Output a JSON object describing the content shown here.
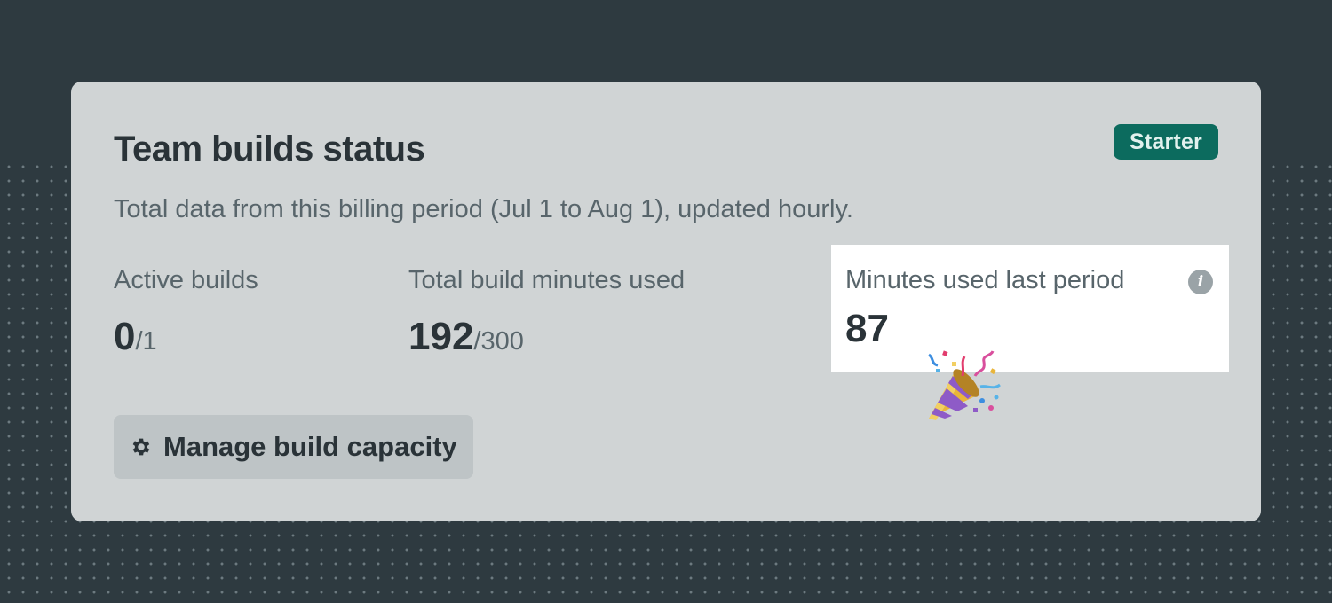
{
  "card": {
    "title": "Team builds status",
    "badge": "Starter",
    "subtitle": "Total data from this billing period (Jul 1 to Aug 1), updated hourly."
  },
  "stats": {
    "active_builds": {
      "label": "Active builds",
      "value": "0",
      "limit": "/1"
    },
    "total_minutes": {
      "label": "Total build minutes used",
      "value": "192",
      "limit": "/300"
    },
    "last_period": {
      "label": "Minutes used last period",
      "value": "87",
      "info_icon": "info-icon"
    }
  },
  "button": {
    "label": "Manage build capacity",
    "icon": "gear-icon"
  },
  "decoration": {
    "emoji": "party-popper-icon"
  },
  "colors": {
    "background": "#2e3a40",
    "card": "#d0d4d5",
    "badge": "#0c6b5e",
    "text_primary": "#2a3338",
    "text_secondary": "#58656b",
    "highlight": "#ffffff"
  }
}
